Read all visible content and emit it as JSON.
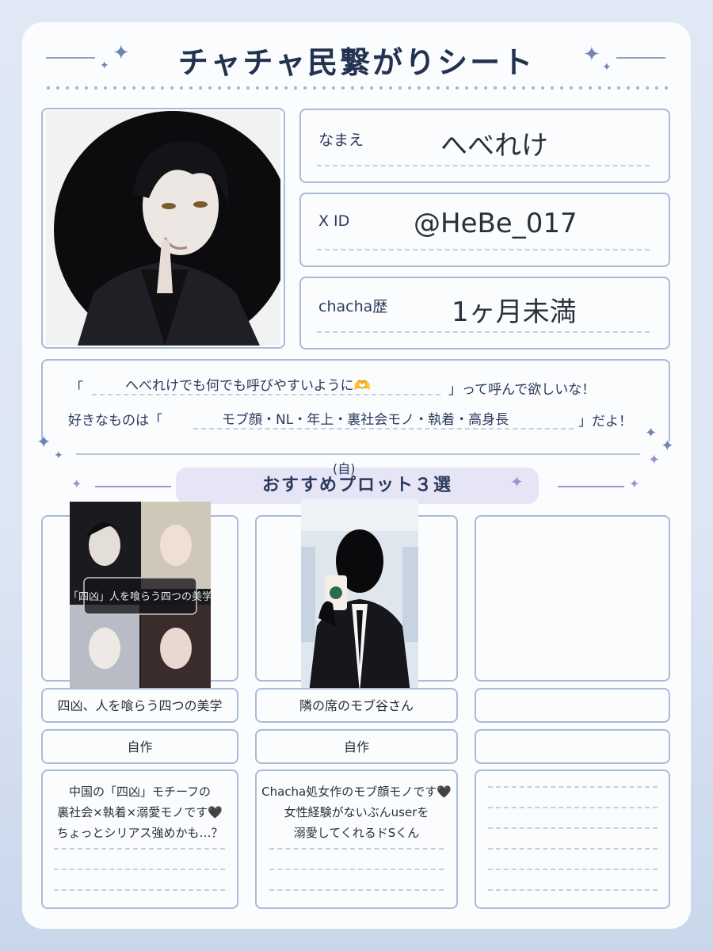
{
  "title": "チャチャ民繋がりシート",
  "profile": {
    "name_label": "なまえ",
    "name_value": "へべれけ",
    "xid_label": "X ID",
    "xid_value": "@HeBe_017",
    "history_label": "chacha歴",
    "history_value": "1ヶ月未満"
  },
  "message": {
    "line1_open": "「",
    "line1_fill": "へべれけでも何でも呼びやすいように🫶",
    "line1_close": "」って呼んで欲しいな！",
    "line2_open": "好きなものは「",
    "line2_fill": "モブ顔・NL・年上・裏社会モノ・執着・高身長",
    "line2_close": "」だよ！"
  },
  "section": {
    "note": "(自)",
    "title": "おすすめプロット３選"
  },
  "plots": [
    {
      "title": "四凶、人を喰らう四つの美学",
      "author": "自作",
      "description": [
        "中国の「四凶」モチーフの",
        "裏社会×執着×溺愛モノです🖤",
        "ちょっとシリアス強めかも…？"
      ],
      "cover_text": "「四凶」人を喰らう四つの美学"
    },
    {
      "title": "隣の席のモブ谷さん",
      "author": "自作",
      "description": [
        "Chacha処女作のモブ顔モノです🖤",
        "女性経験がないぶんuserを",
        "溺愛してくれるドSくん"
      ]
    },
    {
      "title": "",
      "author": "",
      "description": []
    }
  ]
}
